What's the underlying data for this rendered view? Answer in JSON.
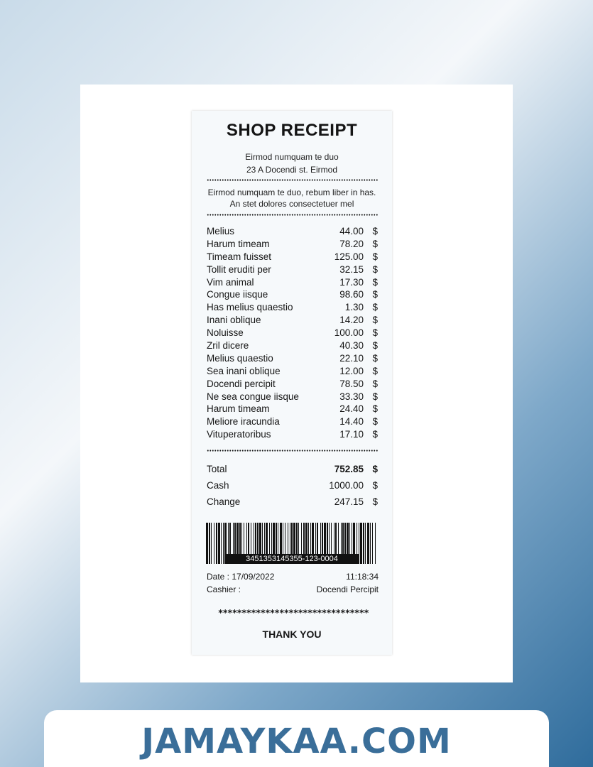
{
  "receipt": {
    "title": "SHOP RECEIPT",
    "address_line1": "Eirmod numquam te duo",
    "address_line2": "23 A Docendi st. Eirmod",
    "note_line1": "Eirmod numquam te duo, rebum liber in has.",
    "note_line2": "An stet dolores consectetuer mel",
    "currency": "$",
    "items": [
      {
        "name": "Melius",
        "price": "44.00"
      },
      {
        "name": "Harum timeam",
        "price": "78.20"
      },
      {
        "name": "Timeam fuisset",
        "price": "125.00"
      },
      {
        "name": "Tollit eruditi per",
        "price": "32.15"
      },
      {
        "name": "Vim animal",
        "price": "17.30"
      },
      {
        "name": "Congue iisque",
        "price": "98.60"
      },
      {
        "name": "Has melius quaestio",
        "price": "1.30"
      },
      {
        "name": "Inani oblique",
        "price": "14.20"
      },
      {
        "name": "Noluisse",
        "price": "100.00"
      },
      {
        "name": "Zril dicere",
        "price": "40.30"
      },
      {
        "name": "Melius quaestio",
        "price": "22.10"
      },
      {
        "name": "Sea inani oblique",
        "price": "12.00"
      },
      {
        "name": "Docendi percipit",
        "price": "78.50"
      },
      {
        "name": "Ne sea congue iisque",
        "price": "33.30"
      },
      {
        "name": "Harum timeam",
        "price": "24.40"
      },
      {
        "name": "Meliore iracundia",
        "price": "14.40"
      },
      {
        "name": "Vituperatoribus",
        "price": "17.10"
      }
    ],
    "total_label": "Total",
    "total_value": "752.85",
    "cash_label": "Cash",
    "cash_value": "1000.00",
    "change_label": "Change",
    "change_value": "247.15",
    "barcode_number": "3451353145355-123-0004",
    "date_text": "Date : 17/09/2022",
    "time_text": "11:18:34",
    "cashier_label": "Cashier :",
    "cashier_name": "Docendi Percipit",
    "stars": "********************************",
    "thanks": "THANK YOU"
  },
  "banner": {
    "text": "JAMAYKAA.COM"
  },
  "colors": {
    "banner_text": "#3a6e99",
    "receipt_bg": "#f6f9fb"
  }
}
